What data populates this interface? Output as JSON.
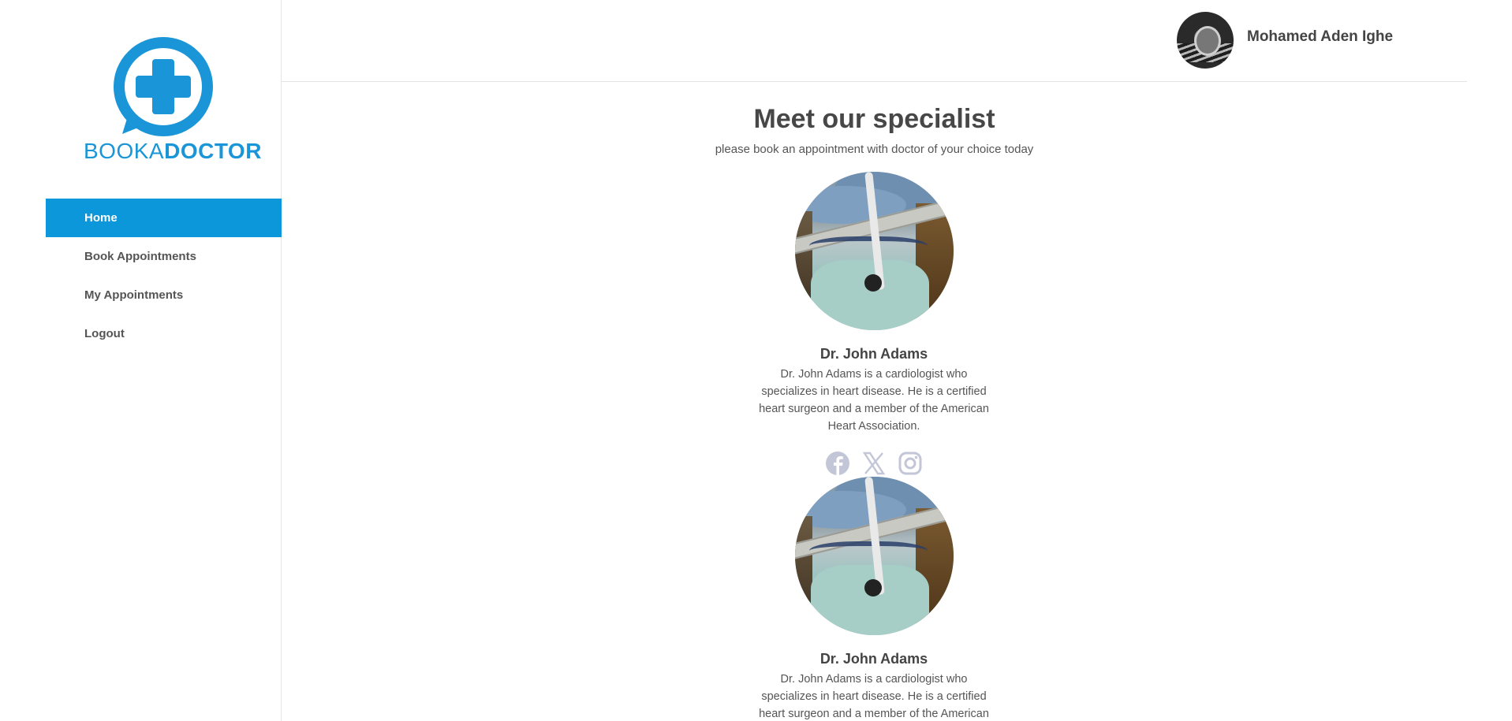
{
  "brand": {
    "logo_text_light": "BOOKA",
    "logo_text_bold": "DOCTOR",
    "accent_color": "#0b97da"
  },
  "sidebar": {
    "items": [
      {
        "label": "Home",
        "active": true
      },
      {
        "label": "Book Appointments",
        "active": false
      },
      {
        "label": "My Appointments",
        "active": false
      },
      {
        "label": "Logout",
        "active": false
      }
    ]
  },
  "header": {
    "user_name": "Mohamed Aden Ighe"
  },
  "main": {
    "title": "Meet our specialist",
    "subtitle": "please book an appointment with doctor of your choice today",
    "doctors": [
      {
        "name": "Dr. John Adams",
        "bio": "Dr. John Adams is a cardiologist who specializes in heart disease. He is a certified heart surgeon and a member of the American Heart Association.",
        "social_icons": [
          "facebook-icon",
          "x-icon",
          "instagram-icon"
        ]
      },
      {
        "name": "Dr. John Adams",
        "bio": "Dr. John Adams is a cardiologist who specializes in heart disease. He is a certified heart surgeon and a member of the American Heart Association."
      }
    ]
  }
}
